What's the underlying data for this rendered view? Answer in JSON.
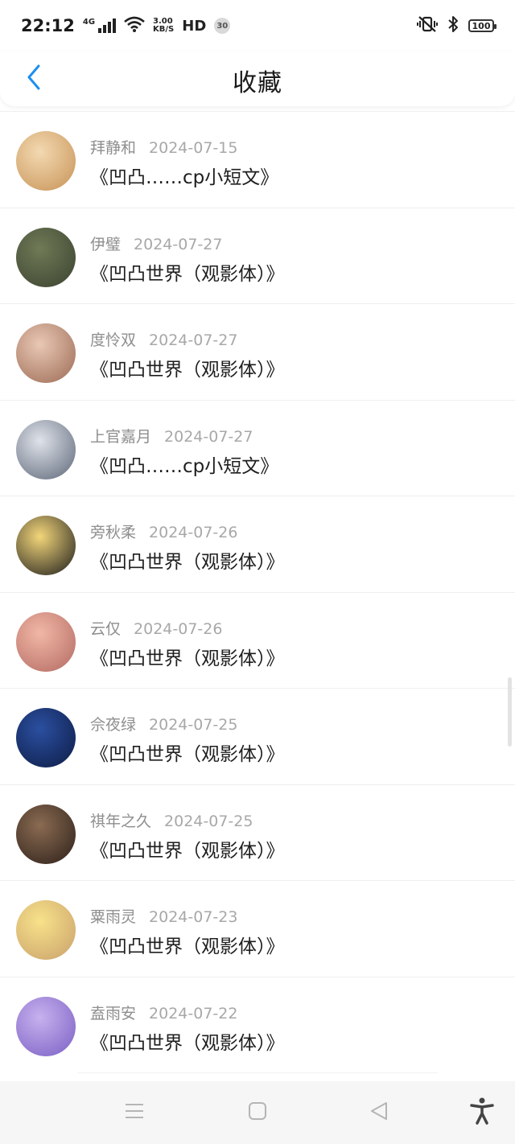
{
  "status_bar": {
    "time": "22:12",
    "network": "4G",
    "speed_value": "3.00",
    "speed_unit": "KB/S",
    "hd": "HD",
    "badge": "30",
    "battery": "100"
  },
  "header": {
    "title": "收藏"
  },
  "items": [
    {
      "author": "拜静和",
      "date": "2024-07-15",
      "work": "《凹凸……cp小短文》",
      "avatar_colors": [
        "#f3d9b1",
        "#c79256"
      ]
    },
    {
      "author": "伊璧",
      "date": "2024-07-27",
      "work": "《凹凸世界（观影体）》",
      "avatar_colors": [
        "#6f7a56",
        "#3b4230"
      ]
    },
    {
      "author": "度怜双",
      "date": "2024-07-27",
      "work": "《凹凸世界（观影体）》",
      "avatar_colors": [
        "#e9c8b4",
        "#9b6a54"
      ]
    },
    {
      "author": "上官嘉月",
      "date": "2024-07-27",
      "work": "《凹凸……cp小短文》",
      "avatar_colors": [
        "#dfe3ea",
        "#5d6678"
      ]
    },
    {
      "author": "旁秋柔",
      "date": "2024-07-26",
      "work": "《凹凸世界（观影体）》",
      "avatar_colors": [
        "#f3d67a",
        "#1b1b1b"
      ]
    },
    {
      "author": "云仅",
      "date": "2024-07-26",
      "work": "《凹凸世界（观影体）》",
      "avatar_colors": [
        "#f1b7a6",
        "#b36a62"
      ]
    },
    {
      "author": "佘夜绿",
      "date": "2024-07-25",
      "work": "《凹凸世界（观影体）》",
      "avatar_colors": [
        "#2b4fa0",
        "#0d1c45"
      ]
    },
    {
      "author": "祺年之久",
      "date": "2024-07-25",
      "work": "《凹凸世界（观影体）》",
      "avatar_colors": [
        "#8a6b52",
        "#2d2019"
      ]
    },
    {
      "author": "粟雨灵",
      "date": "2024-07-23",
      "work": "《凹凸世界（观影体）》",
      "avatar_colors": [
        "#f7e28a",
        "#c9a06b"
      ]
    },
    {
      "author": "盍雨安",
      "date": "2024-07-22",
      "work": "《凹凸世界（观影体）》",
      "avatar_colors": [
        "#c7b1ee",
        "#7a5fc4"
      ]
    }
  ],
  "icons": {
    "back": "chevron-left-icon",
    "menu": "menu-icon",
    "home": "square-icon",
    "back_sys": "triangle-back-icon",
    "accessibility": "accessibility-icon"
  },
  "colors": {
    "accent": "#1e8ff0"
  }
}
